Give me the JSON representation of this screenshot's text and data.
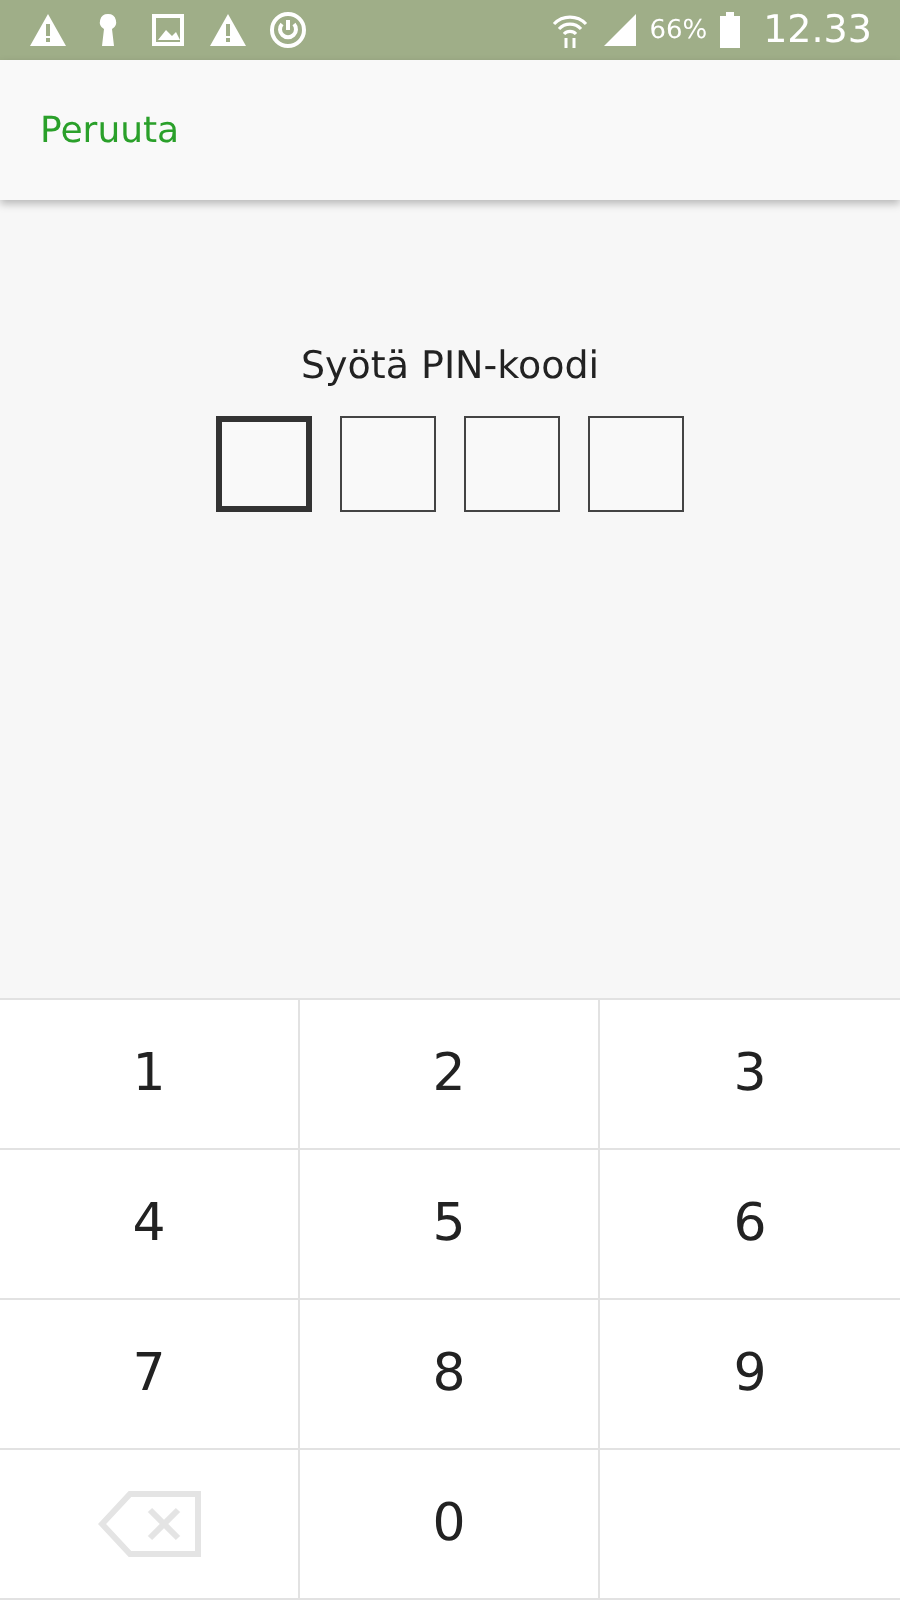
{
  "status_bar": {
    "battery": "66%",
    "time": "12.33"
  },
  "header": {
    "cancel": "Peruuta"
  },
  "prompt": "Syötä PIN-koodi",
  "pin_boxes": [
    {
      "selected": true
    },
    {
      "selected": false
    },
    {
      "selected": false
    },
    {
      "selected": false
    }
  ],
  "keypad": [
    {
      "kind": "digit",
      "label": "1"
    },
    {
      "kind": "digit",
      "label": "2"
    },
    {
      "kind": "digit",
      "label": "3"
    },
    {
      "kind": "digit",
      "label": "4"
    },
    {
      "kind": "digit",
      "label": "5"
    },
    {
      "kind": "digit",
      "label": "6"
    },
    {
      "kind": "digit",
      "label": "7"
    },
    {
      "kind": "digit",
      "label": "8"
    },
    {
      "kind": "digit",
      "label": "9"
    },
    {
      "kind": "backspace",
      "disabled": true
    },
    {
      "kind": "digit",
      "label": "0"
    },
    {
      "kind": "empty"
    }
  ]
}
